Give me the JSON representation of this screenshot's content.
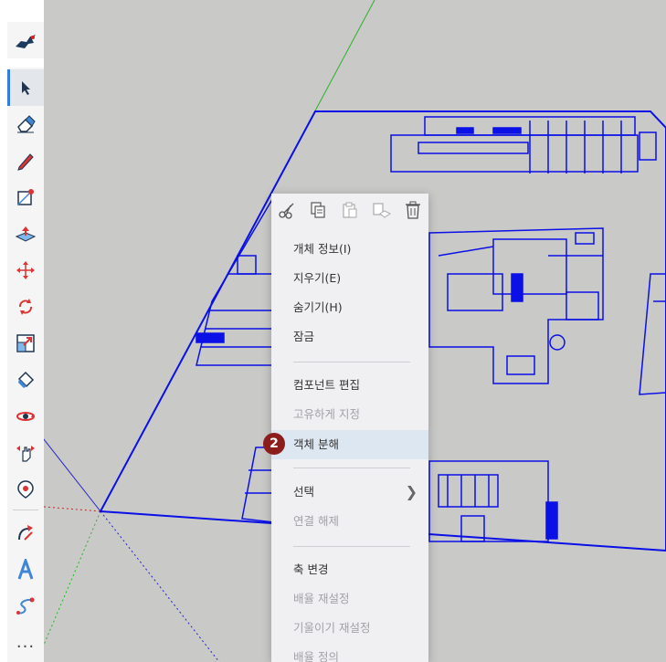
{
  "toolbar": {
    "logo_icon": "sketchup-logo-icon",
    "tools": [
      {
        "name": "select-tool",
        "icon": "arrow-cursor-icon",
        "active": true
      },
      {
        "name": "eraser-tool",
        "icon": "eraser-icon"
      },
      {
        "name": "pencil-tool",
        "icon": "pencil-icon"
      },
      {
        "name": "rectangle-tool",
        "icon": "rectangle-icon"
      },
      {
        "name": "push-pull-tool",
        "icon": "push-pull-icon"
      },
      {
        "name": "move-tool",
        "icon": "move-icon"
      },
      {
        "name": "rotate-tool",
        "icon": "rotate-icon"
      },
      {
        "name": "scale-tool",
        "icon": "scale-icon"
      },
      {
        "name": "paint-bucket-tool",
        "icon": "paint-bucket-icon"
      },
      {
        "name": "orbit-tool",
        "icon": "orbit-icon"
      },
      {
        "name": "pan-tool",
        "icon": "pan-hand-icon"
      },
      {
        "name": "zoom-extents-tool",
        "icon": "zoom-icon"
      },
      {
        "name": "follow-me-tool",
        "icon": "follow-me-icon"
      },
      {
        "name": "text-tool",
        "icon": "text-icon"
      },
      {
        "name": "freehand-tool",
        "icon": "freehand-icon"
      }
    ],
    "more_label": "..."
  },
  "context_menu": {
    "icons": [
      "cut-icon",
      "copy-icon",
      "paste-icon",
      "paste-in-place-icon",
      "delete-icon"
    ],
    "entity_info": "개체 정보(I)",
    "erase": "지우기(E)",
    "hide": "숨기기(H)",
    "lock": "잠금",
    "edit_component": "컴포넌트 편집",
    "make_unique": "고유하게 지정",
    "explode": "객체 분해",
    "select": "선택",
    "unglue": "연결 해제",
    "change_axes": "축 변경",
    "reset_scale": "배율 재설정",
    "reset_skew": "기울이기 재설정",
    "scale_definition": "배율 정의"
  },
  "step_badge": "2",
  "colors": {
    "background": "#c9c9c7",
    "blueprint": "#0a10e6",
    "menu_bg": "#f0eff2",
    "highlight": "#dde7f1",
    "badge": "#8c1d1d"
  }
}
